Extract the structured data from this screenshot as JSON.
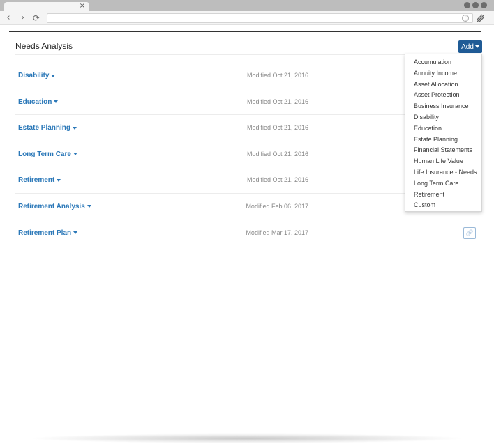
{
  "browser": {
    "tab_close": "×"
  },
  "page": {
    "title": "Needs Analysis",
    "add_label": "Add"
  },
  "analyses": [
    {
      "name": "Disability",
      "modified": "Modified Oct 21, 2016"
    },
    {
      "name": "Education",
      "modified": "Modified Oct 21, 2016"
    },
    {
      "name": "Estate Planning",
      "modified": "Modified Oct 21, 2016"
    },
    {
      "name": "Long Term Care",
      "modified": "Modified Oct 21, 2016"
    },
    {
      "name": "Retirement",
      "modified": "Modified Oct 21, 2016"
    },
    {
      "name": "Retirement Analysis",
      "modified": "Modified Feb 06, 2017"
    },
    {
      "name": "Retirement Plan",
      "modified": "Modified Mar 17, 2017"
    }
  ],
  "add_menu": [
    "Accumulation",
    "Annuity Income",
    "Asset Allocation",
    "Asset Protection",
    "Business Insurance",
    "Disability",
    "Education",
    "Estate Planning",
    "Financial Statements",
    "Human Life Value",
    "Life Insurance - Needs",
    "Long Term Care",
    "Retirement",
    "Custom"
  ],
  "icons": {
    "row_action": "link-icon"
  },
  "colors": {
    "accent": "#1f5b96",
    "link": "#2b78b8"
  }
}
